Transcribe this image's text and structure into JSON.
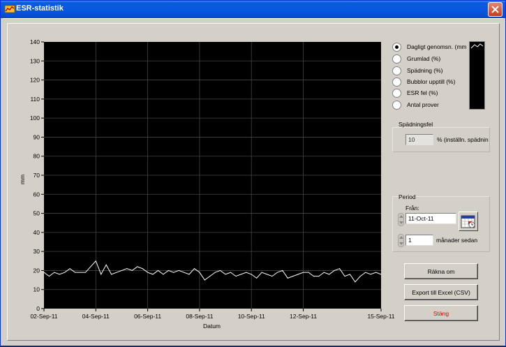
{
  "window": {
    "title": "ESR-statistik"
  },
  "chart_data": {
    "type": "line",
    "ylabel": "mm",
    "xlabel": "Datum",
    "ylim": [
      0,
      140
    ],
    "yticks": [
      0,
      10,
      20,
      30,
      40,
      50,
      60,
      70,
      80,
      90,
      100,
      110,
      120,
      130,
      140
    ],
    "xticks": [
      "02-Sep-11",
      "04-Sep-11",
      "06-Sep-11",
      "08-Sep-11",
      "10-Sep-11",
      "12-Sep-11",
      "15-Sep-11"
    ],
    "xrange": [
      "2011-09-02",
      "2011-09-15"
    ],
    "grid": true,
    "background": "#000000",
    "line_color": "#ffffff",
    "series": [
      {
        "x": [
          "2011-09-02",
          "2011-09-02",
          "2011-09-02",
          "2011-09-02",
          "2011-09-02",
          "2011-09-03",
          "2011-09-03",
          "2011-09-03",
          "2011-09-03",
          "2011-09-03",
          "2011-09-04",
          "2011-09-04",
          "2011-09-04",
          "2011-09-04",
          "2011-09-04",
          "2011-09-05",
          "2011-09-05",
          "2011-09-05",
          "2011-09-05",
          "2011-09-05",
          "2011-09-06",
          "2011-09-06",
          "2011-09-06",
          "2011-09-06",
          "2011-09-06",
          "2011-09-07",
          "2011-09-07",
          "2011-09-07",
          "2011-09-07",
          "2011-09-07",
          "2011-09-08",
          "2011-09-08",
          "2011-09-08",
          "2011-09-08",
          "2011-09-08",
          "2011-09-09",
          "2011-09-09",
          "2011-09-09",
          "2011-09-09",
          "2011-09-09",
          "2011-09-10",
          "2011-09-10",
          "2011-09-10",
          "2011-09-10",
          "2011-09-10",
          "2011-09-11",
          "2011-09-11",
          "2011-09-11",
          "2011-09-11",
          "2011-09-11",
          "2011-09-12",
          "2011-09-12",
          "2011-09-12",
          "2011-09-12",
          "2011-09-12",
          "2011-09-13",
          "2011-09-13",
          "2011-09-13",
          "2011-09-13",
          "2011-09-13",
          "2011-09-14",
          "2011-09-14",
          "2011-09-14",
          "2011-09-14",
          "2011-09-14",
          "2011-09-15"
        ],
        "y": [
          19,
          17,
          19,
          18,
          19,
          21,
          19,
          19,
          19,
          22,
          25,
          18,
          23,
          18,
          19,
          20,
          21,
          20,
          22,
          21,
          19,
          18,
          20,
          18,
          20,
          19,
          20,
          19,
          18,
          21,
          19,
          15,
          17,
          19,
          20,
          18,
          19,
          17,
          18,
          19,
          18,
          16,
          19,
          18,
          17,
          19,
          20,
          16,
          17,
          18,
          19,
          19,
          17,
          17,
          19,
          18,
          20,
          21,
          17,
          18,
          14,
          17,
          19,
          18,
          19,
          18
        ]
      }
    ]
  },
  "plot_selector": {
    "options": [
      {
        "label": "Dagligt genomsn. (mm",
        "checked": true
      },
      {
        "label": "Grumlad (%)",
        "checked": false
      },
      {
        "label": "Spädning (%)",
        "checked": false
      },
      {
        "label": "Bubblor upptill (%)",
        "checked": false
      },
      {
        "label": "ESR fel (%)",
        "checked": false
      },
      {
        "label": "Antal prover",
        "checked": false
      }
    ]
  },
  "dilution_error": {
    "title": "Spädningsfel",
    "value": "10",
    "unit_label": "% (inställn. spädnin"
  },
  "period": {
    "title": "Period",
    "from_label": "Från:",
    "from_value": "11-Oct-11",
    "months_value": "1",
    "months_label": "månader sedan"
  },
  "buttons": {
    "recalc": "Räkna om",
    "export": "Export till Excel (CSV)",
    "close": "Stäng"
  }
}
